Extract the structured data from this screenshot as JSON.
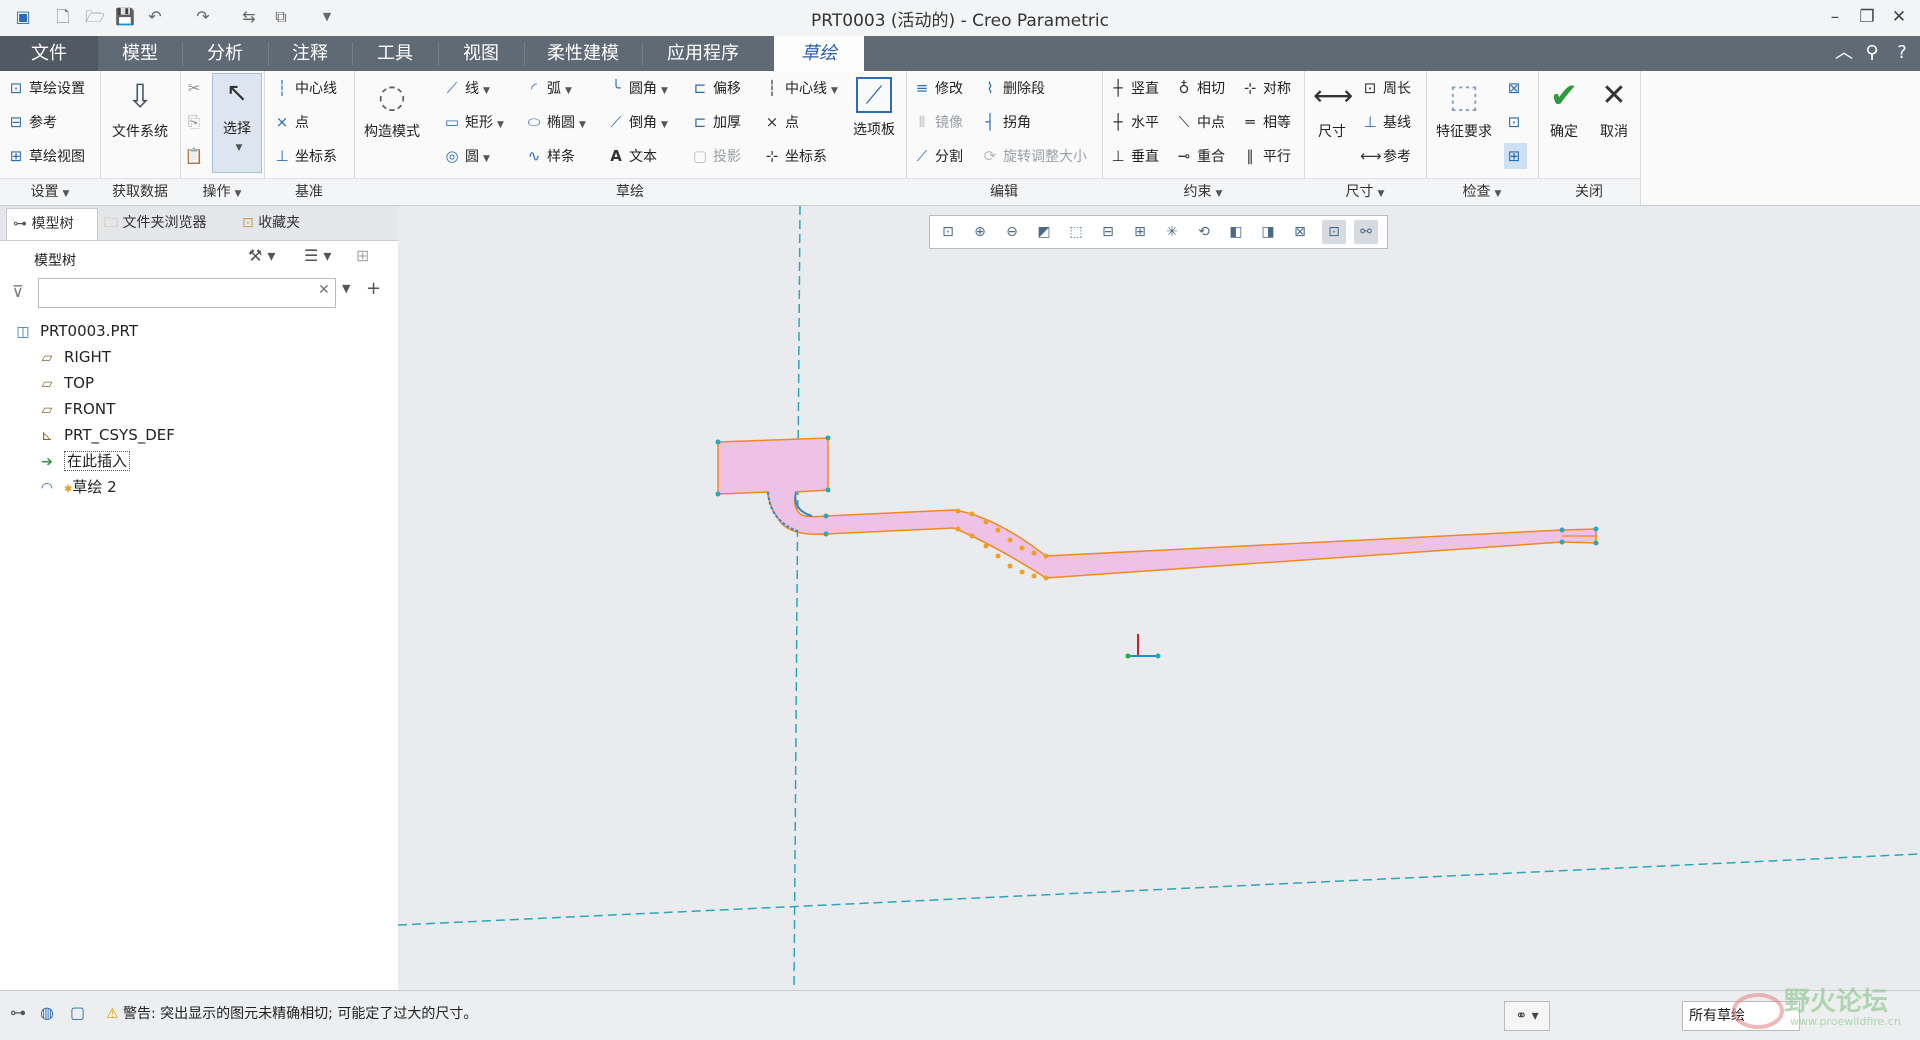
{
  "window": {
    "title": "PRT0003 (活动的) - Creo Parametric"
  },
  "tabs": [
    {
      "label": "文件"
    },
    {
      "label": "模型"
    },
    {
      "label": "分析"
    },
    {
      "label": "注释"
    },
    {
      "label": "工具"
    },
    {
      "label": "视图"
    },
    {
      "label": "柔性建模"
    },
    {
      "label": "应用程序"
    },
    {
      "label": "草绘"
    }
  ],
  "ribbon": {
    "groups": {
      "settings": "设置",
      "get_data": "获取数据",
      "operations": "操作",
      "datum": "基准",
      "sketch": "草绘",
      "edit": "编辑",
      "constrain": "约束",
      "dimension": "尺寸",
      "inspect": "检查",
      "close": "关闭"
    },
    "settings": {
      "sketch_setup": "草绘设置",
      "references": "参考",
      "sketch_view": "草绘视图"
    },
    "get_data": {
      "file_system": "文件系统"
    },
    "operations": {
      "select": "选择"
    },
    "datum": {
      "centerline": "中心线",
      "point": "点",
      "csys": "坐标系"
    },
    "construction_mode": "构造模式",
    "sketch": {
      "line": "线",
      "rectangle": "矩形",
      "circle": "圆",
      "arc": "弧",
      "ellipse": "椭圆",
      "spline": "样条",
      "fillet": "圆角",
      "chamfer": "倒角",
      "text": "文本",
      "offset": "偏移",
      "thicken": "加厚",
      "project": "投影",
      "centerline": "中心线",
      "point": "点",
      "csys": "坐标系",
      "palette": "选项板"
    },
    "edit": {
      "modify": "修改",
      "mirror": "镜像",
      "divide": "分割",
      "delete_segment": "删除段",
      "corner": "拐角",
      "rotate_resize": "旋转调整大小"
    },
    "constrain": {
      "vertical": "竖直",
      "horizontal": "水平",
      "perpendicular": "垂直",
      "tangent": "相切",
      "midpoint": "中点",
      "coincident": "重合",
      "symmetric": "对称",
      "equal": "相等",
      "parallel": "平行"
    },
    "dimension": {
      "dimension": "尺寸",
      "perimeter": "周长",
      "baseline": "基线",
      "reference": "参考"
    },
    "inspect": {
      "feature_requirements": "特征要求"
    },
    "close": {
      "ok": "确定",
      "cancel": "取消"
    }
  },
  "left_panel": {
    "tabs": [
      "模型树",
      "文件夹浏览器",
      "收藏夹"
    ],
    "tree_header": "模型树",
    "tree": [
      "PRT0003.PRT",
      "RIGHT",
      "TOP",
      "FRONT",
      "PRT_CSYS_DEF",
      "在此插入",
      "草绘 2"
    ]
  },
  "status": {
    "message": "警告: 突出显示的图元未精确相切; 可能定了过大的尺寸。",
    "filter": "所有草绘"
  },
  "watermark": {
    "text": "野火论坛",
    "url": "www.proewildfire.cn"
  },
  "colors": {
    "tab_bar": "#5f6a75",
    "active_tab_text": "#2a5caa",
    "sketch_fill": "#eec2e6",
    "sketch_edge": "#f08a1e",
    "centerline": "#2aa8b8",
    "ok_check": "#2e9a3c"
  }
}
